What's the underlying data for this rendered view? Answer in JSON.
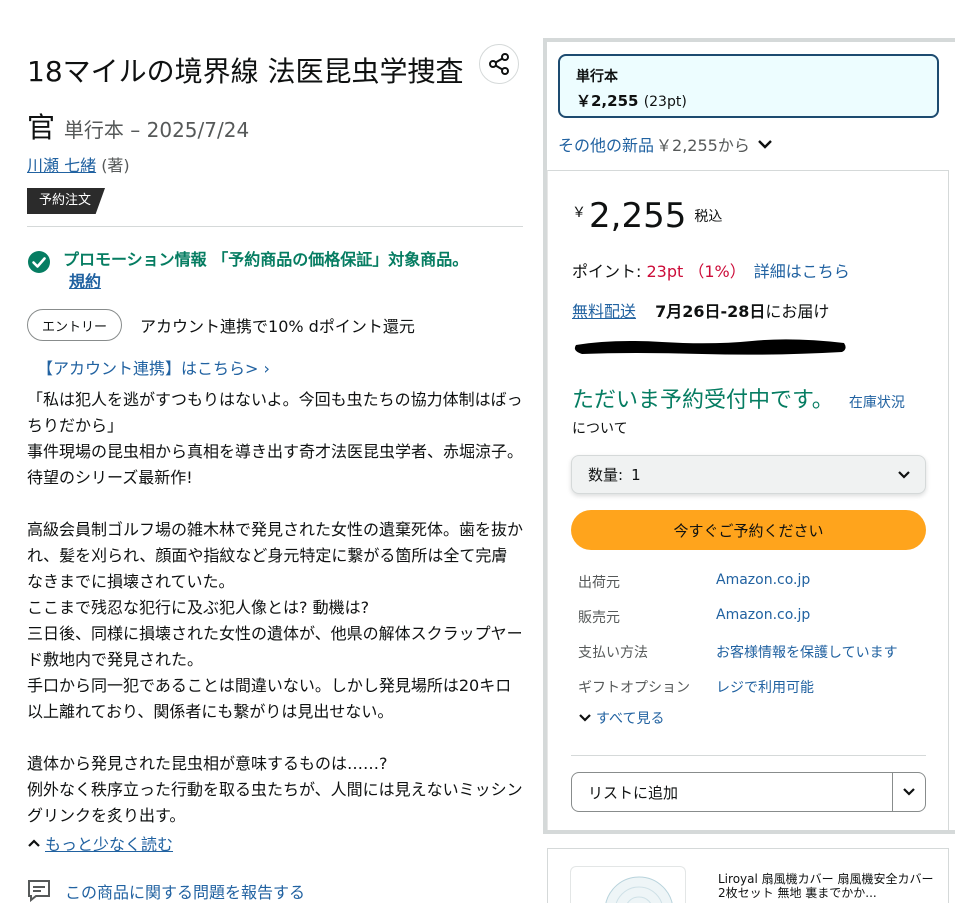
{
  "product": {
    "title": "18マイルの境界線 法医昆虫学捜査官",
    "binding_date": "単行本 – 2025/7/24",
    "author": "川瀬 七緒",
    "author_role": "(著)",
    "badge": "予約注文"
  },
  "promo": {
    "text": "プロモーション情報 「予約商品の価格保証」対象商品。",
    "terms": "規約"
  },
  "entry": {
    "button": "エントリー",
    "text": "アカウント連携で10% dポイント還元",
    "link": "【アカウント連携】はこちら> ›"
  },
  "description": "「私は犯人を逃がすつもりはないよ。今回も虫たちの協力体制はばっちりだから」\n事件現場の昆虫相から真相を導き出す奇才法医昆虫学者、赤堀涼子。待望のシリーズ最新作!\n\n高級会員制ゴルフ場の雑木林で発見された女性の遺棄死体。歯を抜かれ、髪を刈られ、顔面や指紋など身元特定に繋がる箇所は全て完膚なきまでに損壊されていた。\nここまで残忍な犯行に及ぶ犯人像とは? 動機は?\n三日後、同様に損壊された女性の遺体が、他県の解体スクラップヤード敷地内で発見された。\n手口から同一犯であることは間違いない。しかし発見場所は20キロ以上離れており、関係者にも繋がりは見出せない。\n\n遺体から発見された昆虫相が意味するものは……?\n例外なく秩序立った行動を取る虫たちが、人間には見えないミッシングリンクを炙り出す。",
  "read_less": "もっと少なく読む",
  "report": "この商品に関する問題を報告する",
  "buybox": {
    "format_name": "単行本",
    "format_price": "￥2,255",
    "format_points": "(23pt)",
    "other_new_label": "その他の新品",
    "other_new_price": "￥2,255から",
    "price_symbol": "￥",
    "price_value": "2,255",
    "tax_label": "税込",
    "points_label": "ポイント: ",
    "points_value": "23pt （1%）",
    "points_link": "詳細はこちら",
    "free_delivery": "無料配送",
    "delivery_dates": "7月26日-28日",
    "delivery_suffix": "にお届け",
    "preorder_status": "ただいま予約受付中です。",
    "stock_link": "在庫状況",
    "stock_about": "について",
    "qty_label": "数量:",
    "qty_value": "1",
    "preorder_button": "今すぐご予約ください",
    "info": [
      {
        "k": "出荷元",
        "v": "Amazon.co.jp"
      },
      {
        "k": "販売元",
        "v": "Amazon.co.jp"
      },
      {
        "k": "支払い方法",
        "v": "お客様情報を保護しています"
      },
      {
        "k": "ギフトオプション",
        "v": "レジで利用可能"
      }
    ],
    "see_all": "すべて見る",
    "add_to_list": "リストに追加"
  },
  "ad": {
    "text": "Liroyal 扇風機カバー 扇風機安全カバー 2枚セット 無地 裏までかか..."
  },
  "colors": {
    "link": "#2162a1",
    "green": "#067d62",
    "red": "#cc0c39",
    "button_orange": "#ffa41c",
    "format_border": "#1d4b70"
  }
}
